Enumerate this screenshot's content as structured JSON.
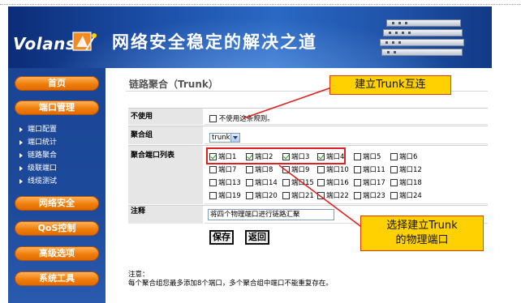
{
  "brand": {
    "logo_text": "Volans"
  },
  "banner": {
    "title": "网络安全稳定的解决之道"
  },
  "menu": {
    "home": "首页",
    "port_management": "端口管理",
    "sub_items": [
      "端口配置",
      "端口统计",
      "链路聚合",
      "级联端口",
      "线缆测试"
    ],
    "network_security": "网络安全",
    "qos": "QoS控制",
    "advanced": "高级选项",
    "system_tools": "系统工具"
  },
  "page": {
    "title": "链路聚合（Trunk）",
    "disable_label": "不使用",
    "disable_option": "不使用这条规则。",
    "group_label": "聚合组",
    "group_value": "trunk1",
    "ports_label": "聚合端口列表",
    "ports": [
      {
        "label": "端口1",
        "checked": true
      },
      {
        "label": "端口2",
        "checked": true
      },
      {
        "label": "端口3",
        "checked": true
      },
      {
        "label": "端口4",
        "checked": true
      },
      {
        "label": "端口5",
        "checked": false
      },
      {
        "label": "端口6",
        "checked": false
      },
      {
        "label": "端口7",
        "checked": false
      },
      {
        "label": "端口8",
        "checked": false
      },
      {
        "label": "端口9",
        "checked": false
      },
      {
        "label": "端口10",
        "checked": false
      },
      {
        "label": "端口11",
        "checked": false
      },
      {
        "label": "端口12",
        "checked": false
      },
      {
        "label": "端口13",
        "checked": false
      },
      {
        "label": "端口14",
        "checked": false
      },
      {
        "label": "端口15",
        "checked": false
      },
      {
        "label": "端口16",
        "checked": false
      },
      {
        "label": "端口17",
        "checked": false
      },
      {
        "label": "端口18",
        "checked": false
      },
      {
        "label": "端口19",
        "checked": false
      },
      {
        "label": "端口20",
        "checked": false
      },
      {
        "label": "端口21",
        "checked": false
      },
      {
        "label": "端口22",
        "checked": false
      },
      {
        "label": "端口23",
        "checked": false
      },
      {
        "label": "端口24",
        "checked": false
      }
    ],
    "note_label": "注释",
    "note_value": "将四个物理端口进行链路汇聚",
    "save": "保存",
    "back": "返回",
    "notice_title": "注意：",
    "notice_text": "每个聚合组您最多添加8个端口，多个聚合组中端口不能重复存在。"
  },
  "annotations": {
    "top": "建立Trunk互连",
    "bottom_line1": "选择建立Trunk",
    "bottom_line2": "的物理端口"
  },
  "colors": {
    "menu_button": "#f07e0c",
    "banner": "#1c4fa8",
    "callout": "#ffd100",
    "highlight": "#e02020"
  }
}
